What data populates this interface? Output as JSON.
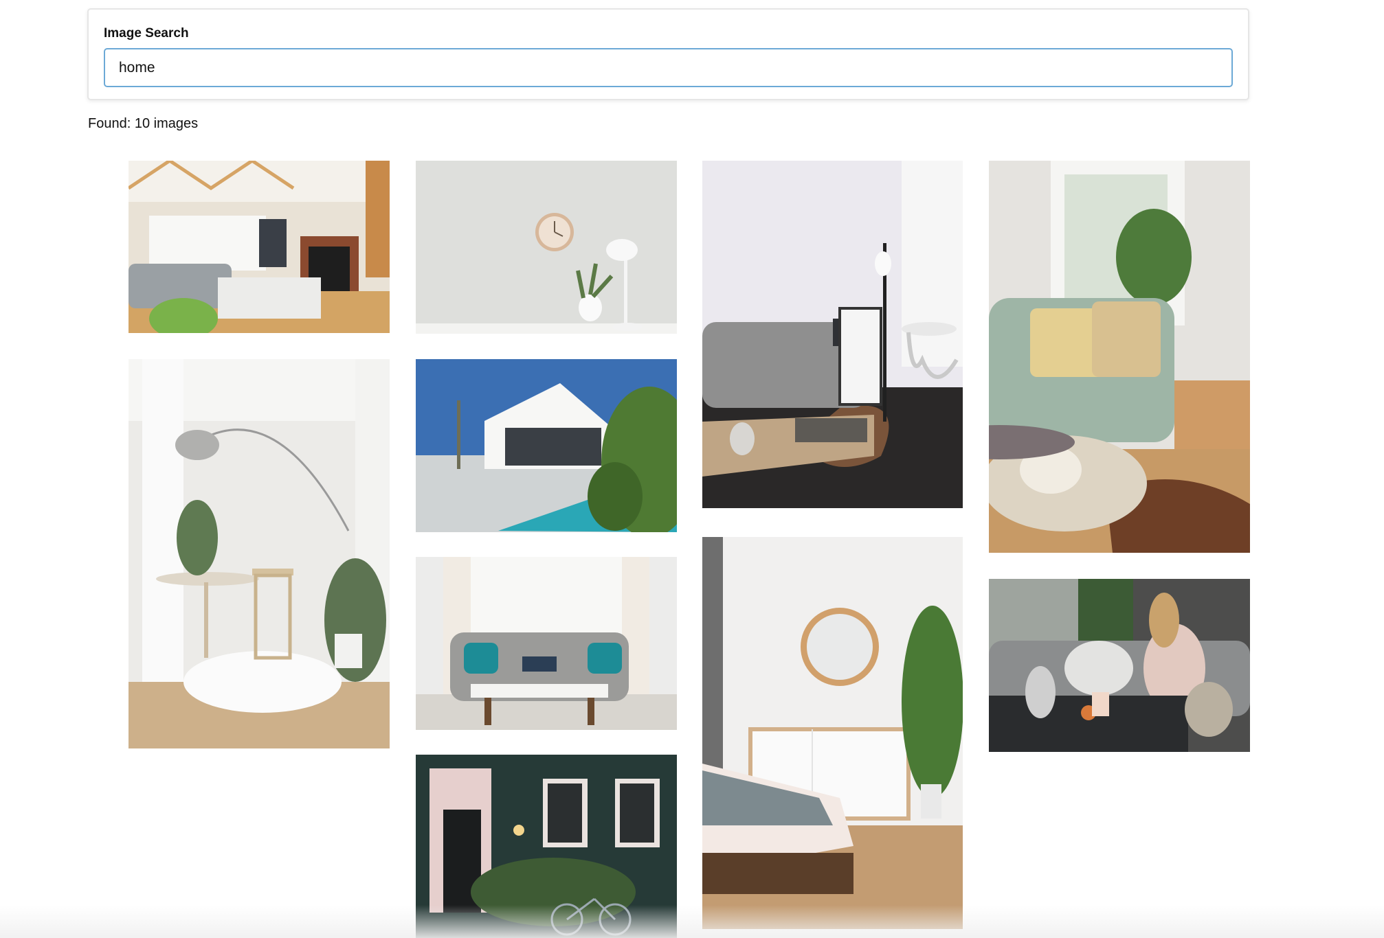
{
  "search": {
    "label": "Image Search",
    "value": "home",
    "placeholder": ""
  },
  "results": {
    "found_text": "Found: 10 images"
  },
  "images": [
    {
      "name": "living-room-fireplace-image"
    },
    {
      "name": "wall-clock-desk-lamp-image"
    },
    {
      "name": "white-dining-corner-image"
    },
    {
      "name": "modern-white-villa-pool-image"
    },
    {
      "name": "gray-tufted-sofa-living-room-image"
    },
    {
      "name": "green-house-front-door-bicycle-image"
    },
    {
      "name": "gray-sofa-coffee-table-image"
    },
    {
      "name": "bedroom-round-mirror-image"
    },
    {
      "name": "green-sofa-french-bulldog-image"
    },
    {
      "name": "woman-on-sofa-with-dog-image"
    }
  ]
}
